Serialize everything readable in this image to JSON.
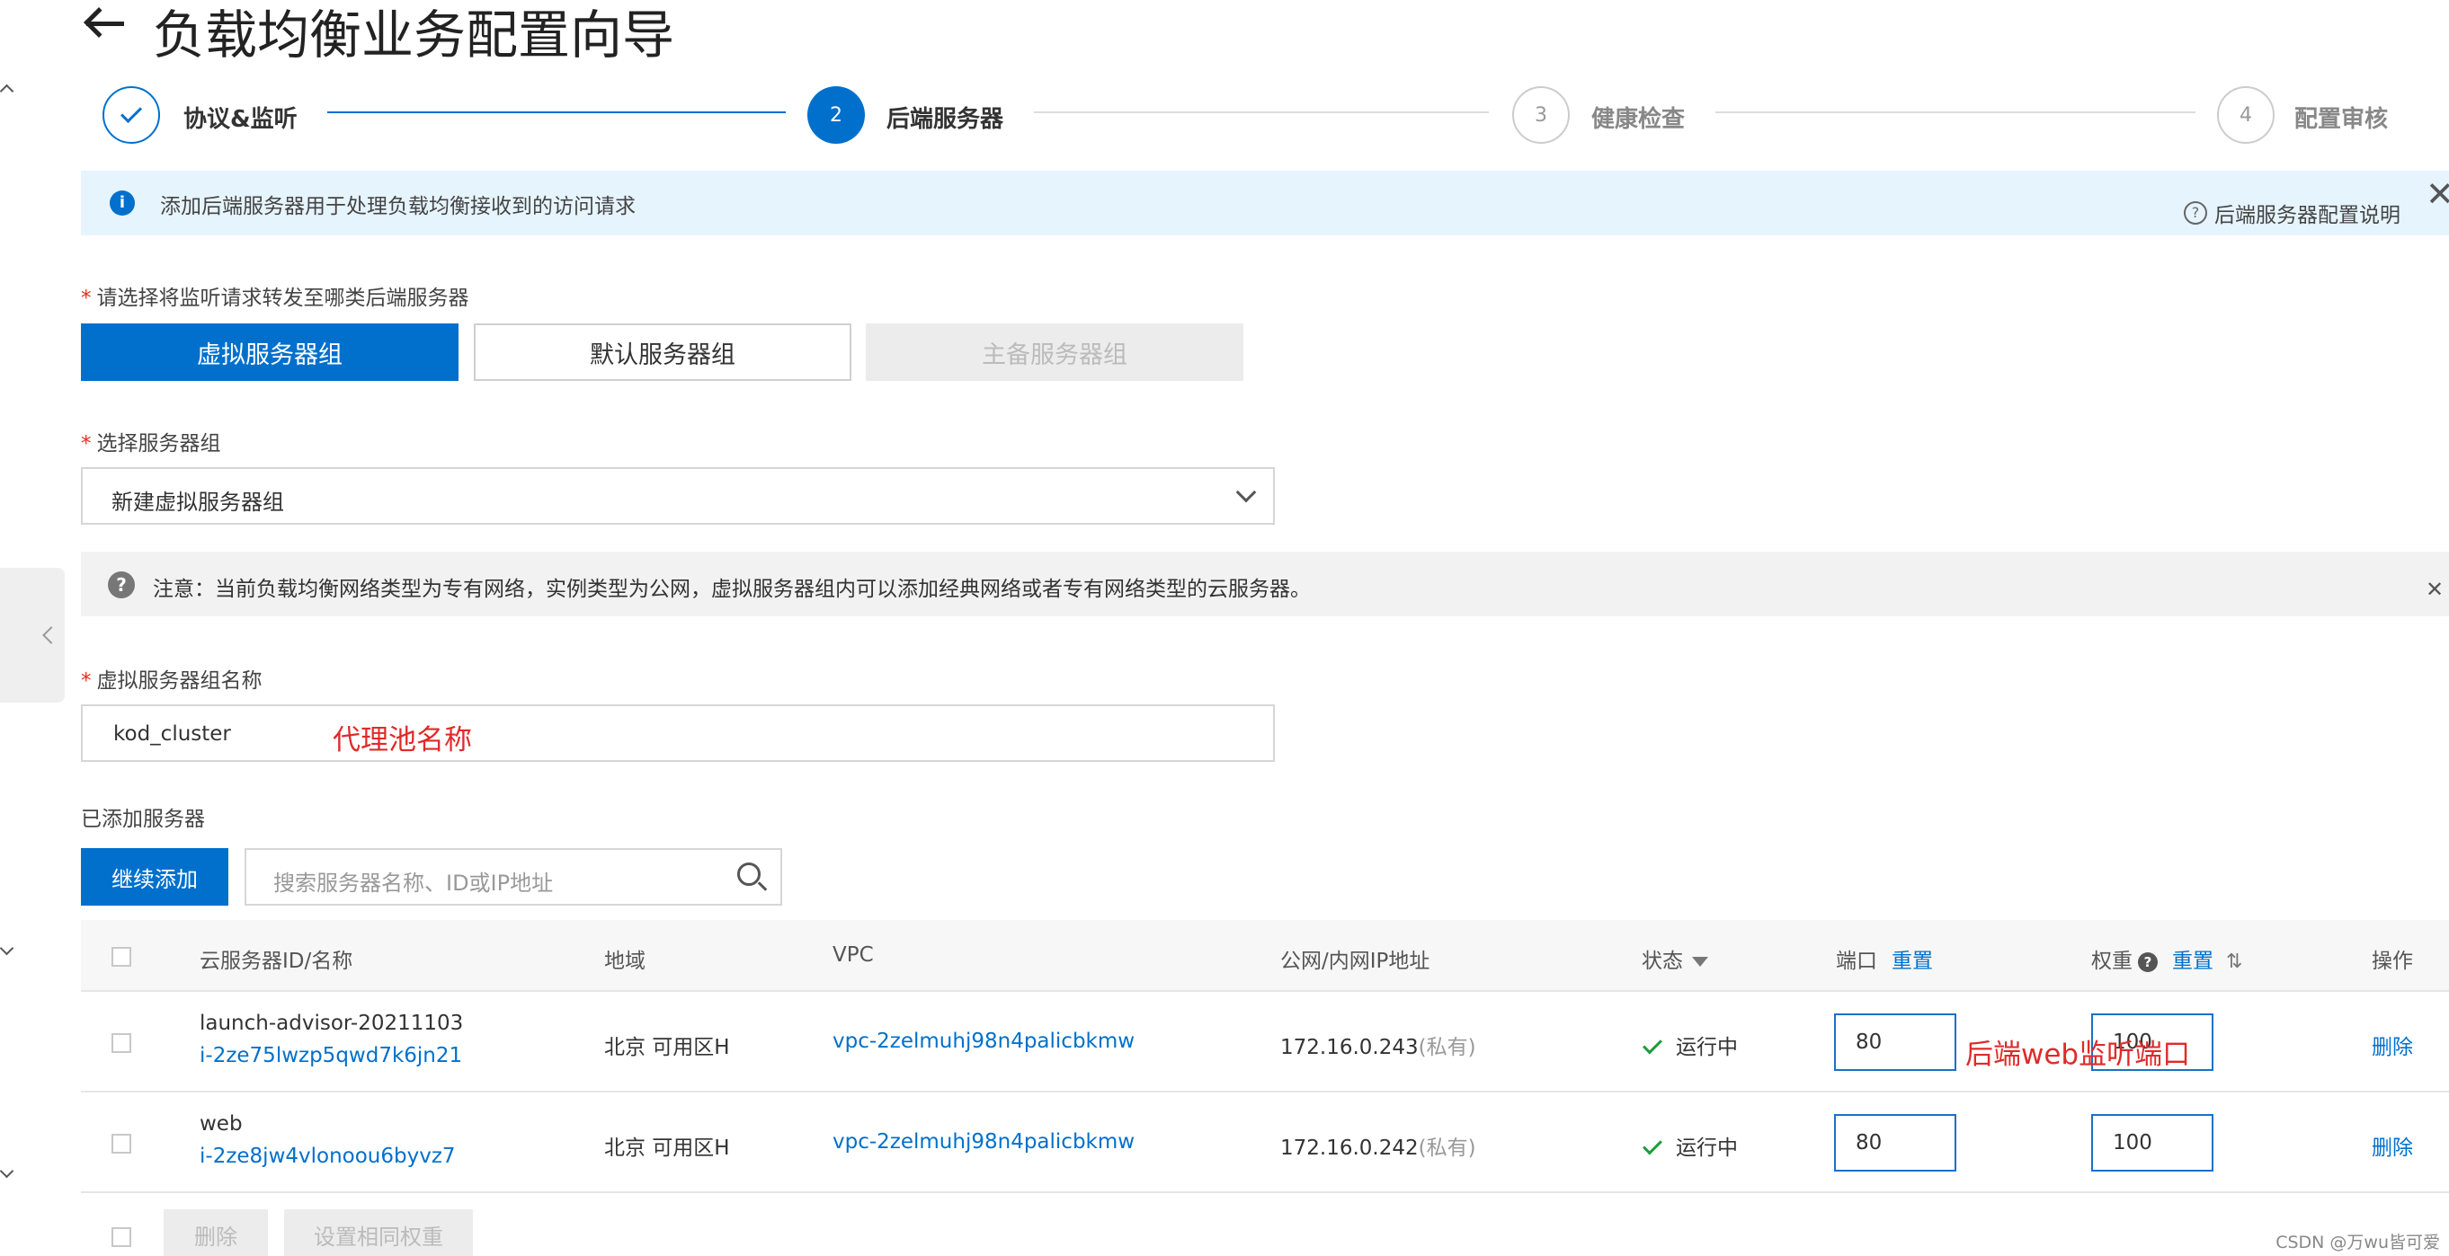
{
  "header": {
    "title": "负载均衡业务配置向导"
  },
  "steps": [
    {
      "number": "",
      "label": "协议&监听",
      "state": "done"
    },
    {
      "number": "2",
      "label": "后端服务器",
      "state": "active"
    },
    {
      "number": "3",
      "label": "健康检查",
      "state": "todo"
    },
    {
      "number": "4",
      "label": "配置审核",
      "state": "todo"
    }
  ],
  "info_banner": {
    "text": "添加后端服务器用于处理负载均衡接收到的访问请求",
    "help_link": "后端服务器配置说明"
  },
  "server_type": {
    "label": "请选择将监听请求转发至哪类后端服务器",
    "options": [
      "虚拟服务器组",
      "默认服务器组",
      "主备服务器组"
    ],
    "selected": "虚拟服务器组"
  },
  "server_group": {
    "label": "选择服务器组",
    "value": "新建虚拟服务器组"
  },
  "notice": {
    "text": "注意：当前负载均衡网络类型为专有网络，实例类型为公网，虚拟服务器组内可以添加经典网络或者专有网络类型的云服务器。"
  },
  "group_name": {
    "label": "虚拟服务器组名称",
    "value": "kod_cluster",
    "annotation": "代理池名称"
  },
  "added_servers": {
    "label": "已添加服务器",
    "add_button": "继续添加",
    "search_placeholder": "搜索服务器名称、ID或IP地址"
  },
  "table": {
    "columns": {
      "id_name": "云服务器ID/名称",
      "region": "地域",
      "vpc": "VPC",
      "ip": "公网/内网IP地址",
      "status": "状态",
      "port": "端口",
      "port_reset": "重置",
      "weight": "权重",
      "weight_reset": "重置",
      "action": "操作"
    },
    "rows": [
      {
        "name": "launch-advisor-20211103",
        "id": "i-2ze75lwzp5qwd7k6jn21",
        "region": "北京 可用区H",
        "vpc": "vpc-2zelmuhj98n4palicbkmw",
        "ip": "172.16.0.243",
        "ip_type": "(私有)",
        "status": "运行中",
        "port": "80",
        "weight": "100",
        "action": "删除"
      },
      {
        "name": "web",
        "id": "i-2ze8jw4vlonoou6byvz7",
        "region": "北京 可用区H",
        "vpc": "vpc-2zelmuhj98n4palicbkmw",
        "ip": "172.16.0.242",
        "ip_type": "(私有)",
        "status": "运行中",
        "port": "80",
        "weight": "100",
        "action": "删除"
      }
    ],
    "port_annotation": "后端web监听端口"
  },
  "footer": {
    "delete_button": "删除",
    "set_weight_button": "设置相同权重"
  },
  "watermark": "CSDN @万wu皆可爱",
  "colors": {
    "primary": "#0070cc",
    "annotation": "#e02a2a",
    "running": "#1a9e3a"
  }
}
